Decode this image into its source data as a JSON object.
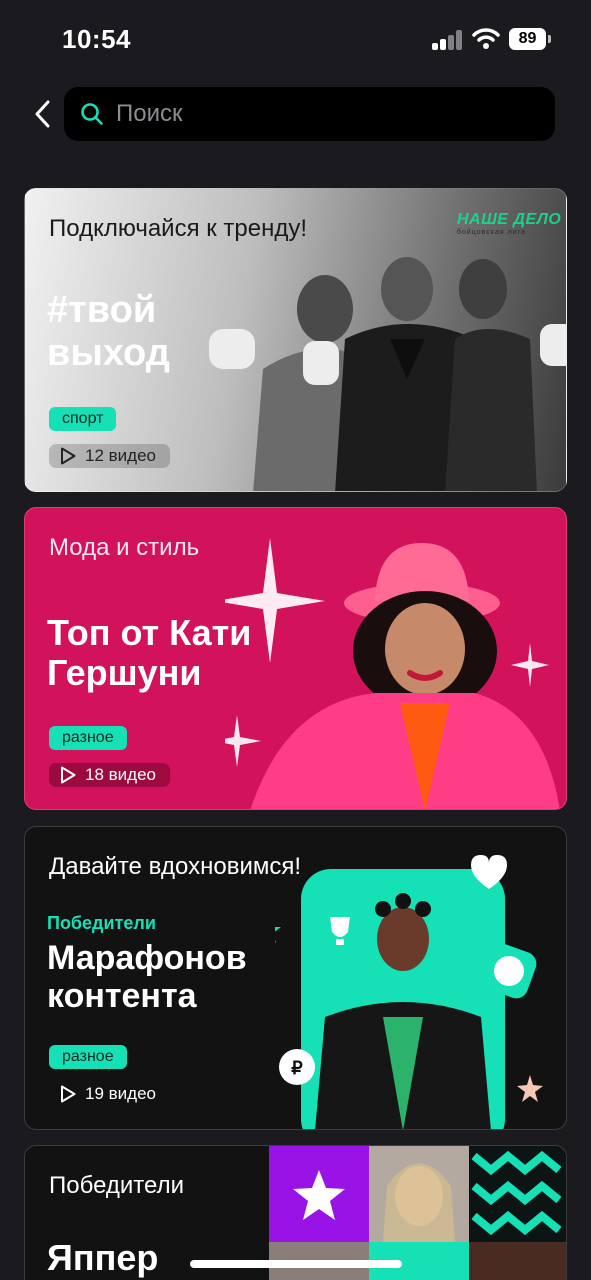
{
  "status_bar": {
    "time": "10:54",
    "battery": "89"
  },
  "search": {
    "placeholder": "Поиск"
  },
  "cards": [
    {
      "kicker": "Подключайся к тренду!",
      "title_line1": "#твой",
      "title_line2": "выход",
      "tag": "спорт",
      "count": "12 видео",
      "brand": "НАШЕ ДЕЛО",
      "brand_sub": "бойцовская лига"
    },
    {
      "kicker": "Мода и стиль",
      "title_line1": "Топ от Кати",
      "title_line2": "Гершуни",
      "tag": "разное",
      "count": "18 видео"
    },
    {
      "kicker": "Давайте вдохновимся!",
      "subtitle": "Победители",
      "title_line1": "Марафонов",
      "title_line2": "контента",
      "tag": "разное",
      "count": "19 видео"
    },
    {
      "kicker": "Победители",
      "title_line1": "Яппер"
    }
  ],
  "colors": {
    "accent": "#16e0b5",
    "pink": "#d2135c",
    "background": "#1b1b1f"
  }
}
